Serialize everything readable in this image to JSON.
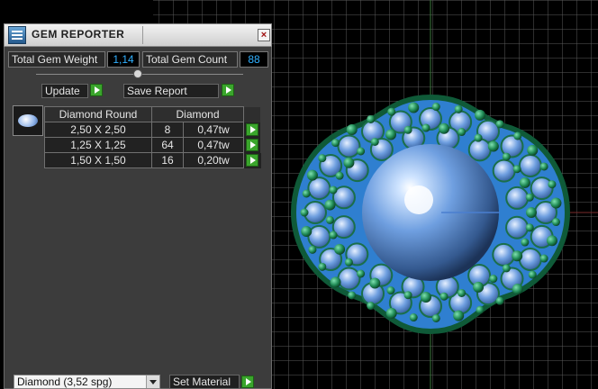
{
  "panel": {
    "title": "GEM REPORTER",
    "close_label": "×"
  },
  "stats": {
    "weight_label": "Total Gem Weight",
    "weight_value": "1,14",
    "count_label": "Total Gem Count",
    "count_value": "88"
  },
  "actions": {
    "update_label": "Update",
    "save_report_label": "Save Report"
  },
  "table": {
    "col1": "Diamond Round",
    "col2": "Diamond",
    "rows": [
      {
        "size": "2,50 X 2,50",
        "count": "8",
        "weight": "0,47tw"
      },
      {
        "size": "1,25 X 1,25",
        "count": "64",
        "weight": "0,47tw"
      },
      {
        "size": "1,50 X 1,50",
        "count": "16",
        "weight": "0,20tw"
      }
    ]
  },
  "material": {
    "selected": "Diamond    (3,52 spg)",
    "set_label": "Set Material"
  },
  "colors": {
    "accent": "#3aa52c",
    "value_text": "#30b0ff",
    "gem_blue": "#6f9fe0",
    "gem_green": "#1f8a55"
  },
  "icons": {
    "app": "gem-reporter-icon",
    "close": "close-icon",
    "go": "play-arrow-icon",
    "thumb": "diamond-round-icon"
  }
}
